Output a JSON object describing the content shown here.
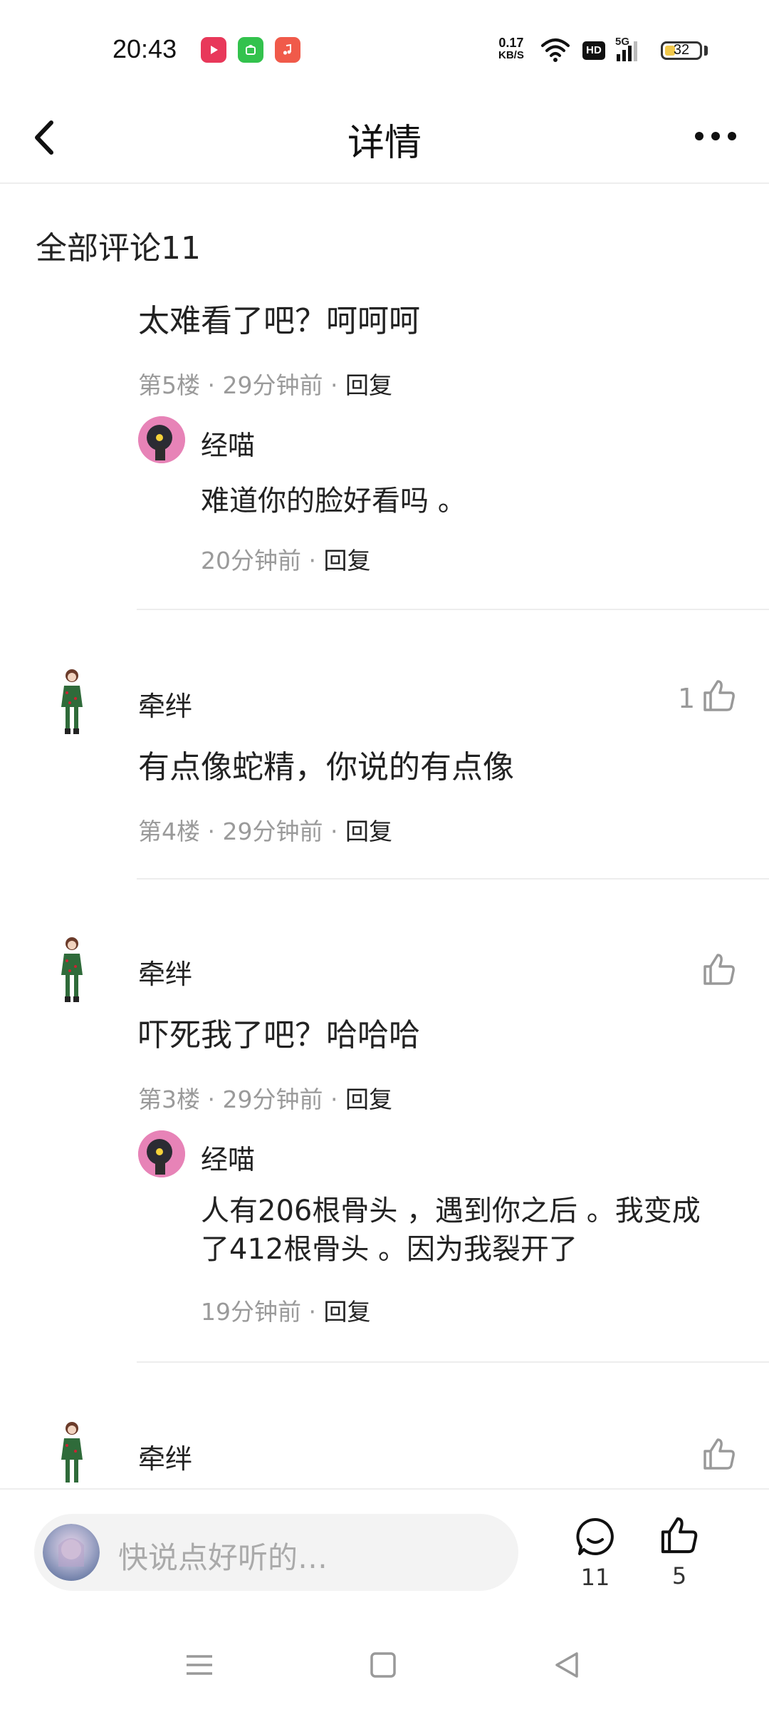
{
  "status_bar": {
    "time": "20:43",
    "net_speed_value": "0.17",
    "net_speed_unit": "KB/S",
    "hd_label": "HD",
    "network_label": "5G",
    "battery_level": "32",
    "app_icons": [
      "video-app-icon",
      "shopping-app-icon",
      "music-app-icon"
    ],
    "colors": {
      "video": "#e8385a",
      "shopping": "#33c24d",
      "music": "#f05a4a",
      "battery": "#f2c94c"
    }
  },
  "header": {
    "title": "详情",
    "back_icon": "chevron-left-icon",
    "more_icon": "more-dots-icon"
  },
  "section": {
    "title": "全部评论11"
  },
  "comments": [
    {
      "text": "太难看了吧？呵呵呵",
      "floor": "第5楼",
      "time": "29分钟前",
      "reply_label": "回复",
      "sub_reply": {
        "author": "经喵",
        "text": "难道你的脸好看吗 。",
        "time": "20分钟前",
        "reply_label": "回复"
      }
    },
    {
      "author": "牵绊",
      "text": "有点像蛇精，你说的有点像",
      "floor": "第4楼",
      "time": "29分钟前",
      "reply_label": "回复",
      "likes": "1"
    },
    {
      "author": "牵绊",
      "text": "吓死我了吧？哈哈哈",
      "floor": "第3楼",
      "time": "29分钟前",
      "reply_label": "回复",
      "sub_reply": {
        "author": "经喵",
        "text_line1": "人有206根骨头 ，遇到你之后 。我变成",
        "text_line2": "了412根骨头 。因为我裂开了",
        "time": "19分钟前",
        "reply_label": "回复"
      }
    },
    {
      "author": "牵绊"
    }
  ],
  "bottom_bar": {
    "input_placeholder": "快说点好听的…",
    "comment_count": "11",
    "like_count": "5"
  },
  "nav_bar": {
    "items": [
      "menu-icon",
      "home-square-icon",
      "back-triangle-icon"
    ]
  }
}
